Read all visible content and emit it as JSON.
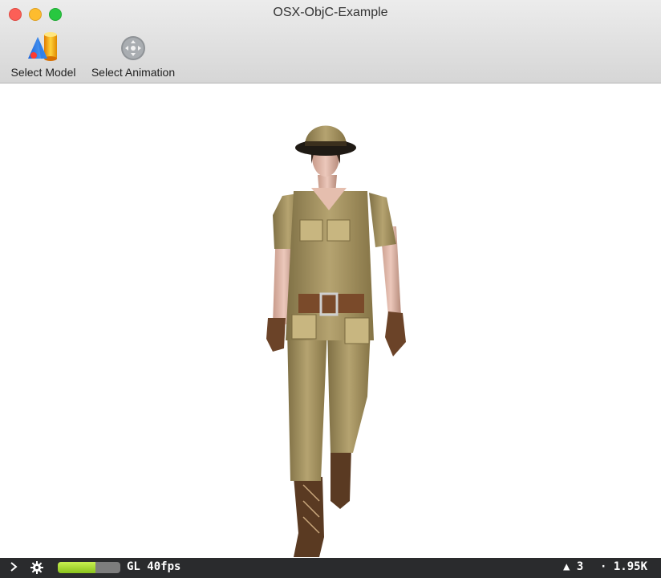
{
  "window": {
    "title": "OSX-ObjC-Example"
  },
  "toolbar": {
    "select_model": {
      "label": "Select Model",
      "icon": "model-icon"
    },
    "select_animation": {
      "label": "Select Animation",
      "icon": "animation-icon"
    }
  },
  "statusbar": {
    "fps_label": "GL 40fps",
    "fps_fraction": 0.6,
    "triangles_label": "▲ 3",
    "vertices_label": "· 1.95K"
  },
  "colors": {
    "close": "#fc5f57",
    "minimize": "#fdbc2e",
    "maximize": "#28c840",
    "fps_bar": "#a6dc32"
  }
}
